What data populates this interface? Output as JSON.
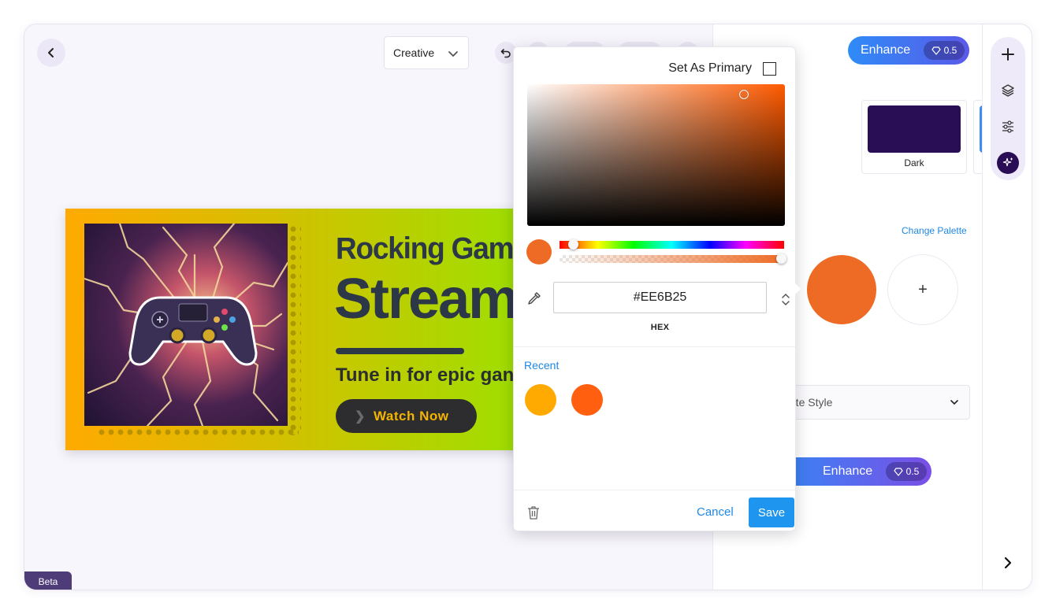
{
  "app": {
    "beta_label": "Beta"
  },
  "toolbar": {
    "style_select_value": "Creative"
  },
  "banner": {
    "title_line1": "Rocking Game",
    "title_line2": "Streams",
    "subtitle": "Tune in for epic gan",
    "cta_label": "Watch Now"
  },
  "panel": {
    "enhance_top_label": "Enhance",
    "enhance_top_cost": "0.5",
    "theme_cards": [
      {
        "label": "",
        "color": "#ece7f8"
      },
      {
        "label": "Dark",
        "color": "#2a0e55"
      },
      {
        "label": "",
        "color": "#3d8cf0"
      }
    ],
    "change_palette_label": "Change Palette",
    "current_swatch_color": "#EE6B25",
    "add_swatch_label": "+",
    "palette_style_placeholder": "ette Style",
    "enhance_bottom_label": "Enhance",
    "enhance_bottom_cost": "0.5"
  },
  "color_picker": {
    "set_primary_label": "Set As Primary",
    "set_primary_checked": false,
    "hue_base_color": "#ff5a00",
    "hex_value": "#EE6B25",
    "hex_label": "HEX",
    "preview_color": "#EE6B25",
    "recent_label": "Recent",
    "recent_colors": [
      "#FFAA00",
      "#FF5F0F"
    ],
    "cancel_label": "Cancel",
    "save_label": "Save"
  },
  "rail": {
    "icons": [
      "plus-icon",
      "layers-icon",
      "sliders-icon",
      "sparkle-icon"
    ],
    "next_icon": "chevron-right-icon"
  }
}
